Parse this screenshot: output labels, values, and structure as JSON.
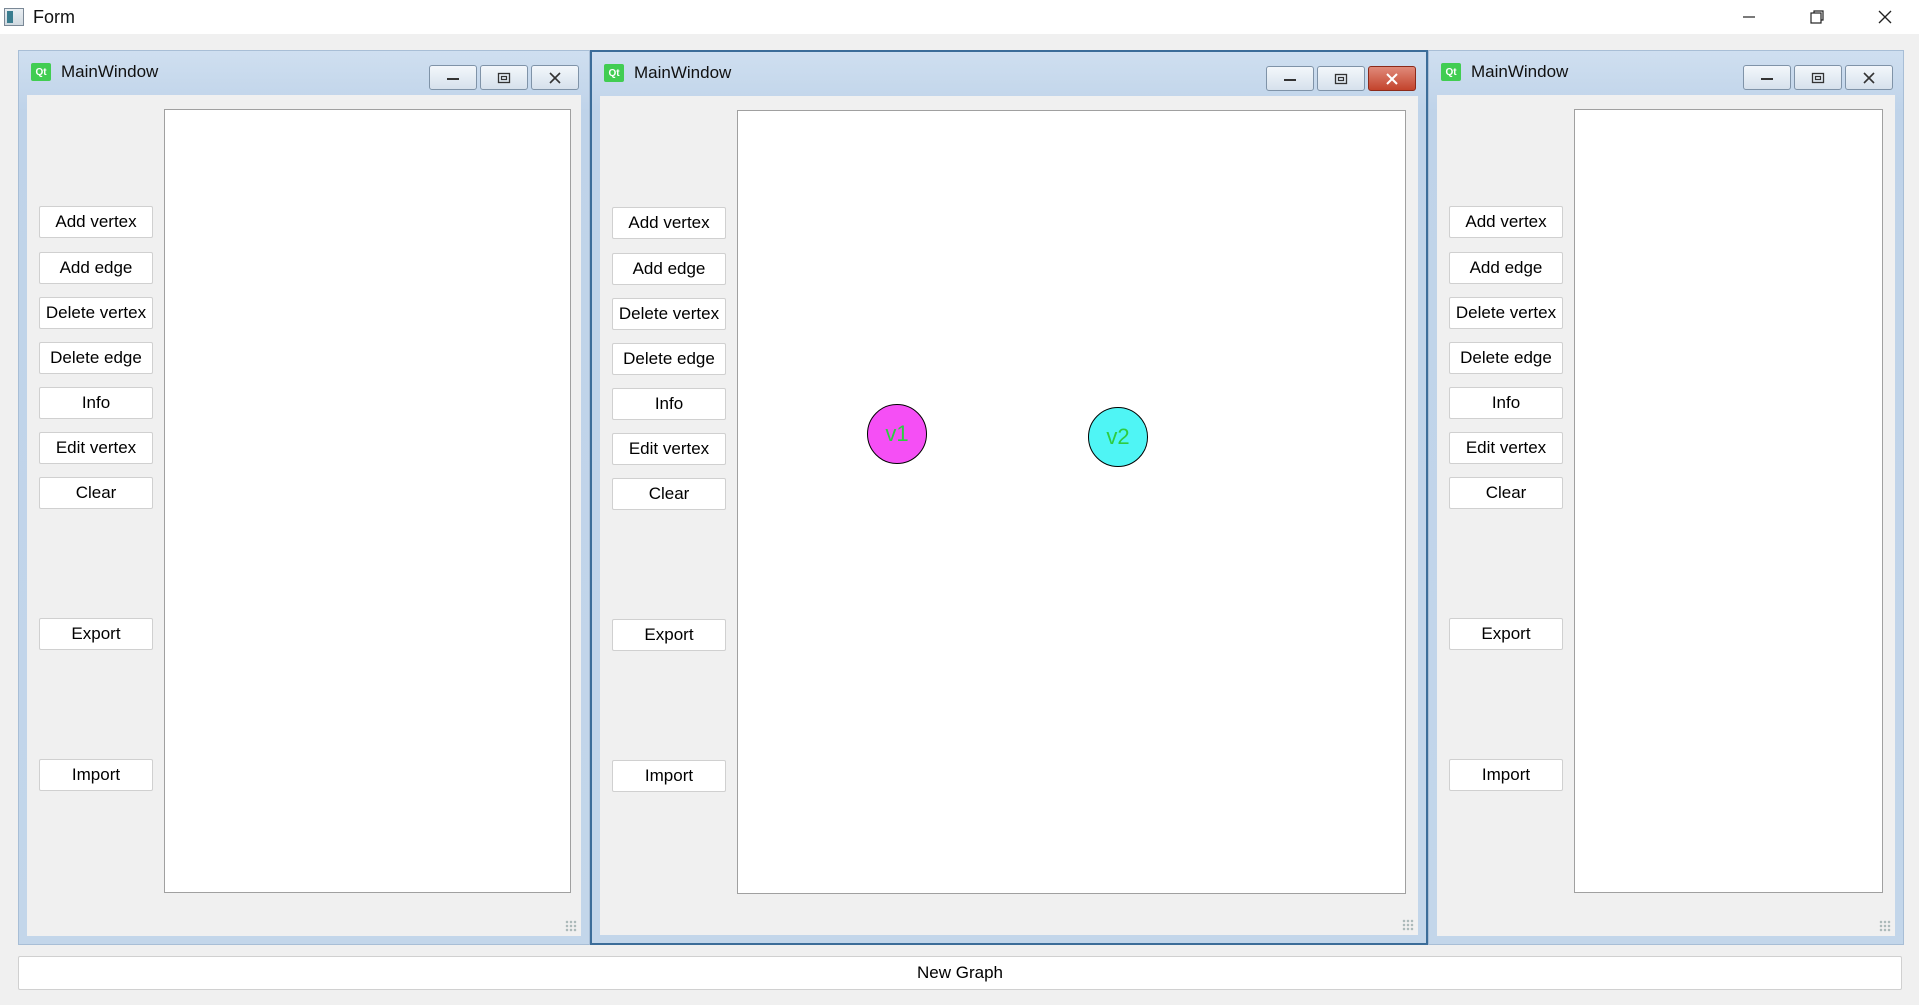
{
  "app": {
    "title": "Form",
    "new_graph_label": "New Graph"
  },
  "windows": [
    {
      "title": "MainWindow",
      "active": false,
      "buttons": {
        "add_vertex": "Add vertex",
        "add_edge": "Add edge",
        "delete_vertex": "Delete vertex",
        "delete_edge": "Delete edge",
        "info": "Info",
        "edit_vertex": "Edit vertex",
        "clear": "Clear",
        "export": "Export",
        "import": "Import"
      },
      "vertices": []
    },
    {
      "title": "MainWindow",
      "active": true,
      "buttons": {
        "add_vertex": "Add vertex",
        "add_edge": "Add edge",
        "delete_vertex": "Delete vertex",
        "delete_edge": "Delete edge",
        "info": "Info",
        "edit_vertex": "Edit vertex",
        "clear": "Clear",
        "export": "Export",
        "import": "Import"
      },
      "vertices": [
        {
          "label": "v1",
          "color": "#f54ff5"
        },
        {
          "label": "v2",
          "color": "#4ff5f5"
        }
      ]
    },
    {
      "title": "MainWindow",
      "active": false,
      "buttons": {
        "add_vertex": "Add vertex",
        "add_edge": "Add edge",
        "delete_vertex": "Delete vertex",
        "delete_edge": "Delete edge",
        "info": "Info",
        "edit_vertex": "Edit vertex",
        "clear": "Clear",
        "export": "Export",
        "import": "Import"
      },
      "vertices": []
    }
  ],
  "colors": {
    "vertex_label": "#2ecc40",
    "qt_badge": "#41cd52",
    "active_close": "#c3432c"
  },
  "icons": {
    "outer_app": "form-app-icon",
    "qt": "qt-logo-icon"
  }
}
